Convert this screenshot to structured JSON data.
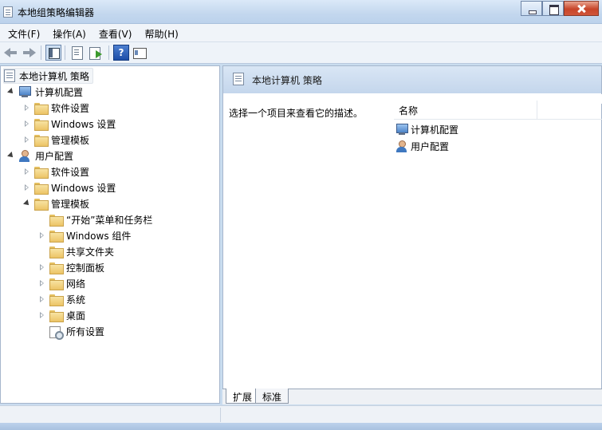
{
  "window": {
    "title": "本地组策略编辑器"
  },
  "menu": [
    "文件(F)",
    "操作(A)",
    "查看(V)",
    "帮助(H)"
  ],
  "toolbar": {
    "help_glyph": "?"
  },
  "tree": {
    "root": "本地计算机 策略",
    "computer_config": "计算机配置",
    "computer_children": [
      "软件设置",
      "Windows 设置",
      "管理模板"
    ],
    "user_config": "用户配置",
    "user_children": [
      "软件设置",
      "Windows 设置",
      "管理模板"
    ],
    "admin_templates_children": [
      "“开始”菜单和任务栏",
      "Windows 组件",
      "共享文件夹",
      "控制面板",
      "网络",
      "系统",
      "桌面",
      "所有设置"
    ]
  },
  "right_pane": {
    "title": "本地计算机 策略",
    "description": "选择一个项目来查看它的描述。",
    "column_name": "名称",
    "items": [
      "计算机配置",
      "用户配置"
    ]
  },
  "tabs": [
    "扩展",
    "标准"
  ]
}
